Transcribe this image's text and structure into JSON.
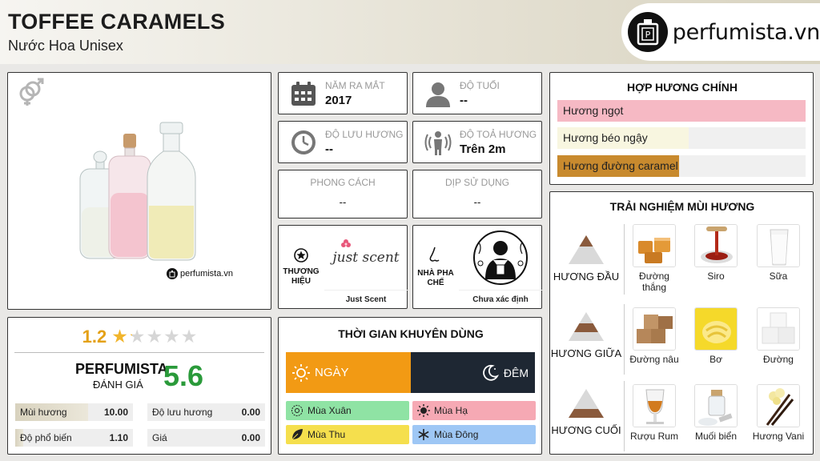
{
  "header": {
    "title": "TOFFEE CARAMELS",
    "subtitle": "Nước Hoa Unisex",
    "logo_text": "perfumista.vn"
  },
  "product": {
    "watermark": "perfumista.vn",
    "icon": "gender-unisex-icon"
  },
  "info": {
    "year": {
      "label": "NĂM RA MẮT",
      "value": "2017",
      "icon": "calendar-icon"
    },
    "age": {
      "label": "ĐỘ TUỔI",
      "value": "--",
      "icon": "person-icon"
    },
    "longevity": {
      "label": "ĐỘ LƯU HƯƠNG",
      "value": "--",
      "icon": "clock-icon"
    },
    "sillage": {
      "label": "ĐỘ TOẢ HƯƠNG",
      "value": "Trên 2m",
      "icon": "sillage-icon"
    },
    "style": {
      "label": "PHONG CÁCH",
      "value": "--"
    },
    "occasion": {
      "label": "DỊP SỬ DỤNG",
      "value": "--"
    },
    "brand": {
      "label_line1": "THƯƠNG",
      "label_line2": "HIỆU",
      "name": "Just Scent",
      "logo_text": "just scent",
      "icon": "star-badge-icon"
    },
    "perfumer": {
      "label_line1": "NHÀ PHA",
      "label_line2": "CHẾ",
      "name": "Chưa xác định",
      "icon": "nose-icon"
    }
  },
  "rating": {
    "score": "1.2",
    "stars": 1.2,
    "perfumista_label": "PERFUMISTA",
    "perfumista_sub": "ĐÁNH GIÁ",
    "perfumista_score": "5.6",
    "metrics": [
      {
        "label": "Mùi hương",
        "value": "10.00",
        "fraction": 0.62
      },
      {
        "label": "Độ lưu hương",
        "value": "0.00",
        "fraction": 0
      },
      {
        "label": "Độ phổ biến",
        "value": "1.10",
        "fraction": 0.07
      },
      {
        "label": "Giá",
        "value": "0.00",
        "fraction": 0
      }
    ]
  },
  "time": {
    "title": "THỜI GIAN KHUYÊN DÙNG",
    "day": "NGÀY",
    "night": "ĐÊM",
    "seasons": [
      {
        "label": "Mùa Xuân",
        "color": "#8fe3a4",
        "icon": "flower-icon"
      },
      {
        "label": "Mùa Hạ",
        "color": "#f6a9b4",
        "icon": "sun-icon"
      },
      {
        "label": "Mùa Thu",
        "color": "#f5df4d",
        "icon": "leaf-icon"
      },
      {
        "label": "Mùa Đông",
        "color": "#9ec7f5",
        "icon": "snowflake-icon"
      }
    ]
  },
  "accords": {
    "title": "HỢP HƯƠNG CHÍNH",
    "items": [
      {
        "label": "Hương ngọt",
        "fraction": 1.0,
        "color": "#f6b9c4"
      },
      {
        "label": "Hương béo ngậy",
        "fraction": 0.53,
        "color": "#f8f6e0"
      },
      {
        "label": "Hương đường caramel",
        "fraction": 0.49,
        "color": "#c88a2e"
      }
    ]
  },
  "notes": {
    "title": "TRẢI NGHIỆM MÙI HƯƠNG",
    "stages": [
      {
        "label": "HƯƠNG ĐẦU",
        "items": [
          "Đường thắng",
          "Siro",
          "Sữa"
        ]
      },
      {
        "label": "HƯƠNG GIỮA",
        "items": [
          "Đường nâu",
          "Bơ",
          "Đường"
        ]
      },
      {
        "label": "HƯƠNG CUỐI",
        "items": [
          "Rượu Rum",
          "Muối biển",
          "Hương Vani"
        ]
      }
    ]
  }
}
